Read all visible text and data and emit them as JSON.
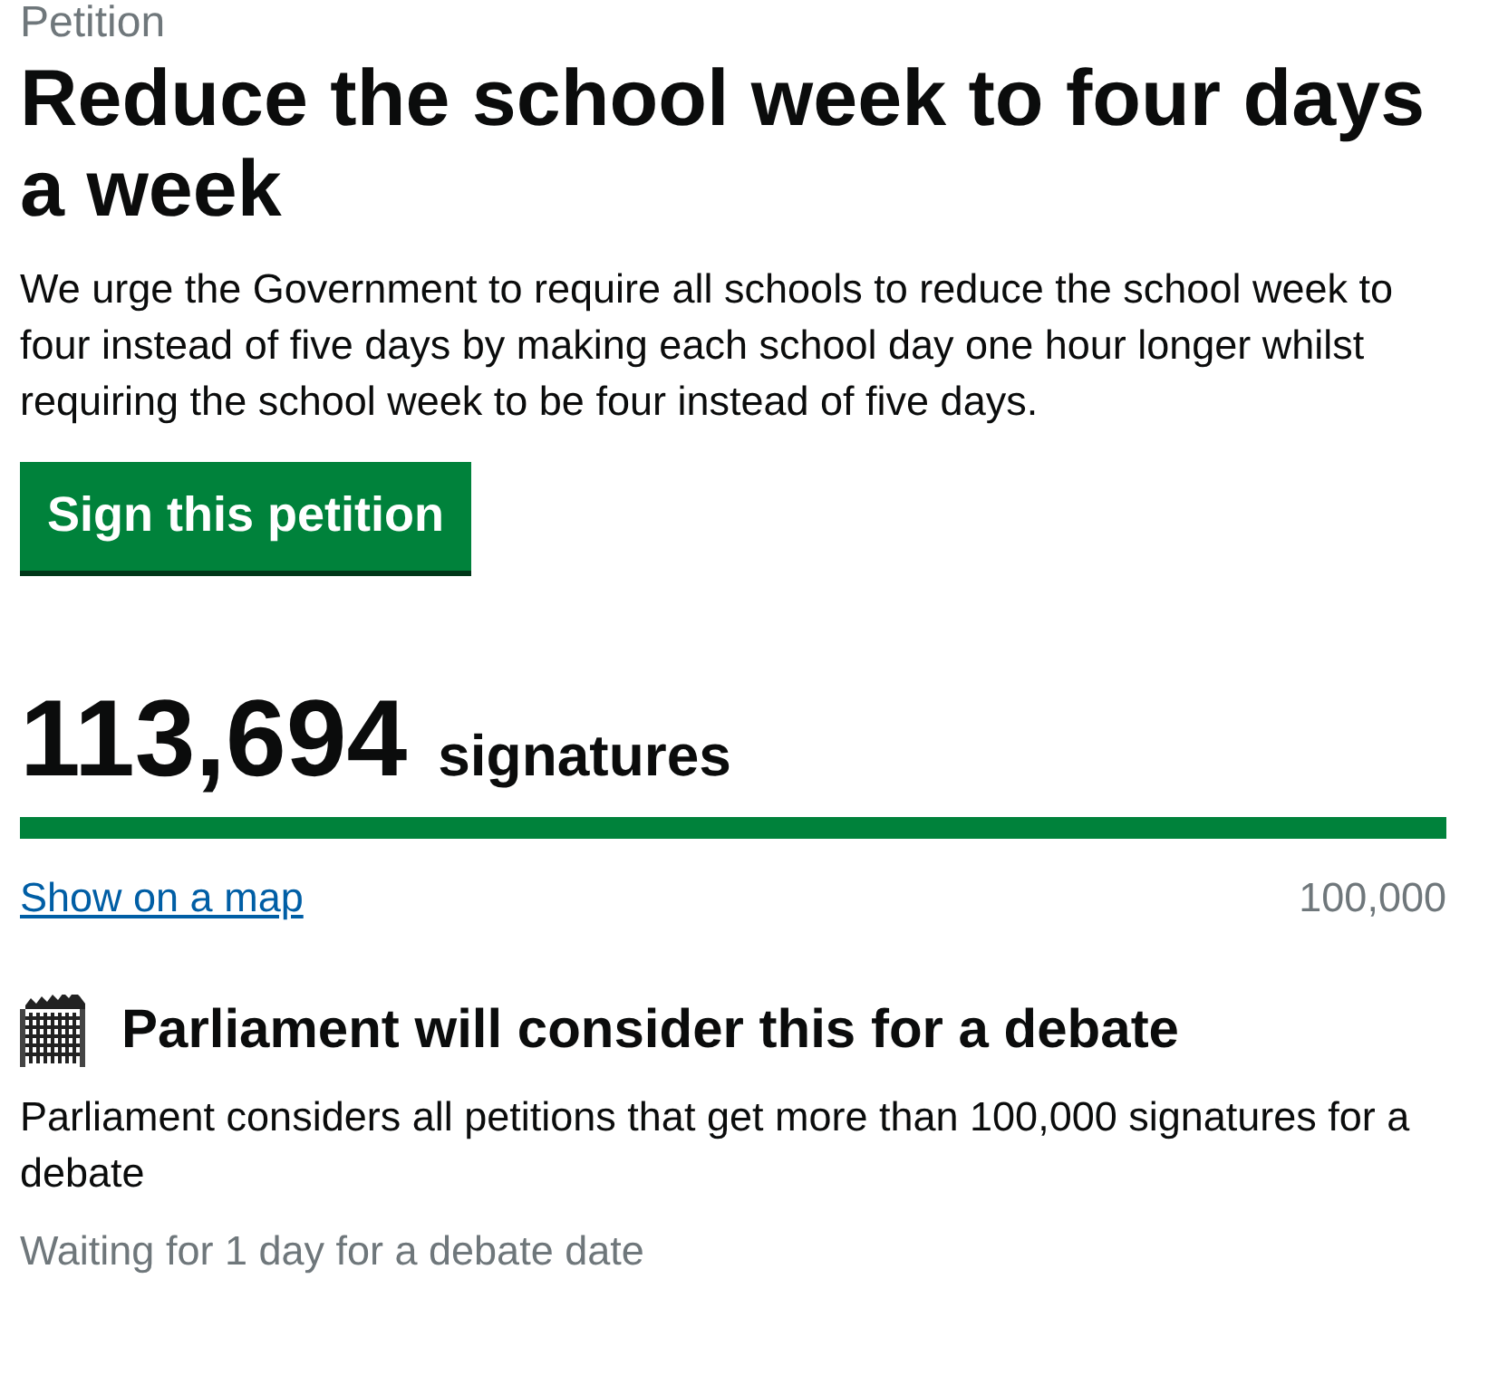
{
  "caption": "Petition",
  "title": "Reduce the school week to four days a week",
  "description": "We urge the Government to require all schools to reduce the school week to four instead of five days by making each school day one hour longer whilst requiring the school week to be four instead of five days.",
  "sign_button": "Sign this petition",
  "signatures": {
    "count": "113,694",
    "label": "signatures",
    "level": 1,
    "map_link": "Show on a map",
    "threshold": "100,000"
  },
  "debate": {
    "heading": "Parliament will consider this for a debate",
    "text": "Parliament considers all petitions that get more than 100,000 signatures for a debate",
    "status": "Waiting for 1 day for a debate date"
  }
}
